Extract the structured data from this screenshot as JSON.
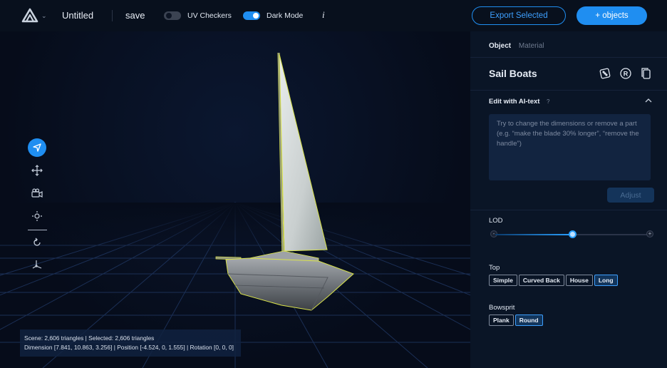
{
  "topbar": {
    "project_name": "Untitled",
    "save_label": "save",
    "uv_checkers": {
      "label": "UV Checkers",
      "on": false
    },
    "dark_mode": {
      "label": "Dark Mode",
      "on": true
    },
    "info_label": "i",
    "export_label": "Export Selected",
    "add_objects_label": "+ objects"
  },
  "viewport": {
    "stats_line1": "Scene: 2,606 triangles | Selected: 2,606 triangles",
    "stats_line2": "Dimension [7.841, 10.863, 3.256] | Position [-4.524, 0, 1.555] | Rotation [0, 0, 0]",
    "tools": [
      "select-icon",
      "move-icon",
      "camera-icon",
      "orbit-icon",
      "rotate-icon",
      "axes-icon"
    ],
    "active_tool": "select-icon"
  },
  "panel": {
    "tabs": [
      {
        "label": "Object",
        "active": true
      },
      {
        "label": "Material",
        "active": false
      }
    ],
    "object_name": "Sail Boats",
    "icons": [
      "randomize-icon",
      "registered-icon",
      "copy-icon"
    ],
    "ai_edit": {
      "title": "Edit with AI-text",
      "help": "?",
      "placeholder": "Try to change the dimensions or remove a part (e.g. “make the blade 30% longer”, “remove the handle”)",
      "adjust_label": "Adjust"
    },
    "lod": {
      "label": "LOD",
      "minus": "-",
      "plus": "+",
      "value": 0.5
    },
    "top": {
      "label": "Top",
      "options": [
        "Simple",
        "Curved Back",
        "House",
        "Long"
      ],
      "selected": "Long"
    },
    "bowsprit": {
      "label": "Bowsprit",
      "options": [
        "Plank",
        "Round"
      ],
      "selected": "Round"
    }
  },
  "colors": {
    "accent": "#1f8ef1",
    "background": "#060c18",
    "panel": "#0a1526",
    "selection_outline": "#d9e24a"
  }
}
